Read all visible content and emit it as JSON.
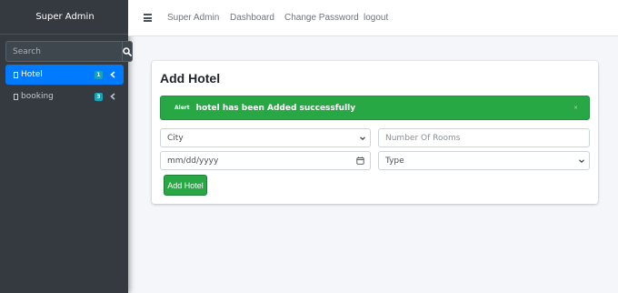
{
  "sidebar": {
    "brand": "Super Admin",
    "search_placeholder": "Search",
    "items": [
      {
        "label": "Hotel",
        "badge": "1",
        "active": true
      },
      {
        "label": "booking",
        "badge": "3",
        "active": false
      }
    ]
  },
  "navbar": {
    "links": [
      "Super Admin",
      "Dashboard",
      "Change Password",
      "logout"
    ]
  },
  "card": {
    "title": "Add Hotel",
    "alert": {
      "tag": "Alert",
      "message": "hotel has been Added successfully",
      "close": "×"
    },
    "city_select": "City",
    "rooms_placeholder": "Number Of Rooms",
    "date_placeholder": "mm/dd/yyyy",
    "type_select": "Type",
    "submit_label": "Add Hotel"
  },
  "colors": {
    "sidebar_bg": "#343a40",
    "active_item": "#007bff",
    "badge": "#17a2b8",
    "success": "#28a745"
  }
}
